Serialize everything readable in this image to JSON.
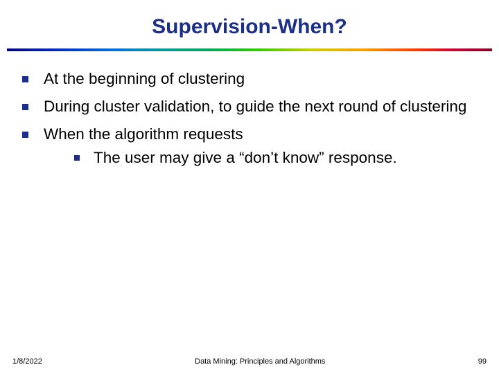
{
  "title": "Supervision-When?",
  "bullets": [
    {
      "text": "At the beginning of clustering"
    },
    {
      "text": "During cluster validation, to guide the next round of clustering"
    },
    {
      "text": "When the algorithm requests",
      "sub": [
        {
          "text": "The user may give a “don’t know” response."
        }
      ]
    }
  ],
  "footer": {
    "date": "1/8/2022",
    "center": "Data Mining: Principles and Algorithms",
    "page": "99"
  }
}
